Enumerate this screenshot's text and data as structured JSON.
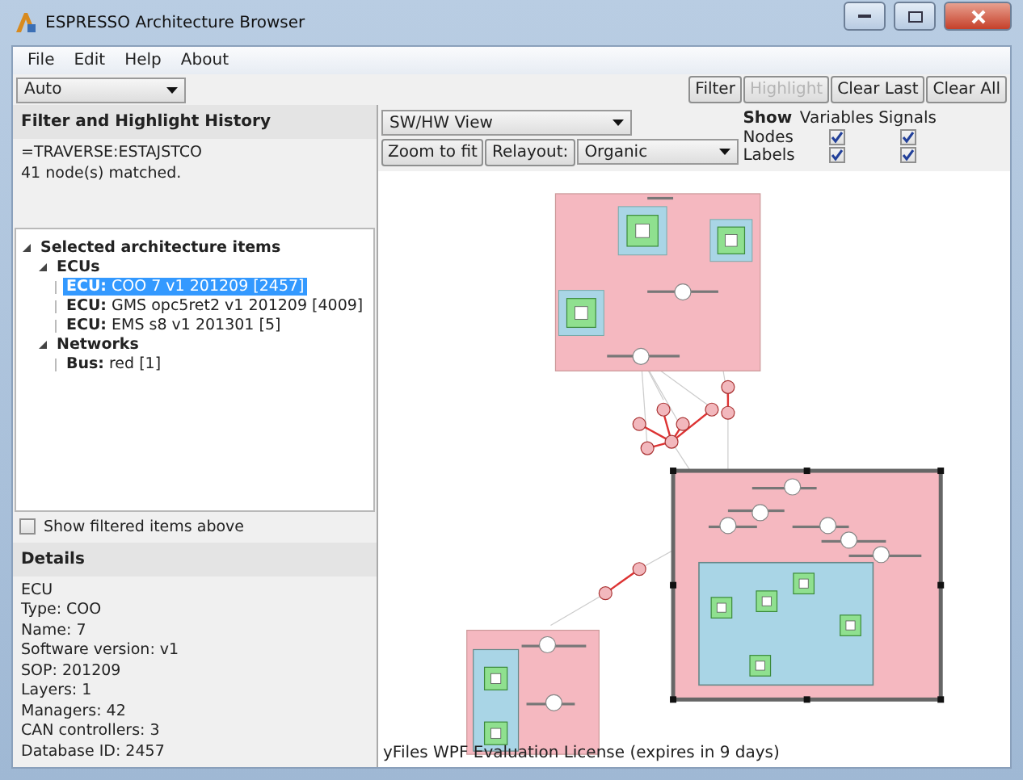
{
  "window": {
    "title": "ESPRESSO Architecture Browser"
  },
  "menu": [
    {
      "label": "File"
    },
    {
      "label": "Edit"
    },
    {
      "label": "Help"
    },
    {
      "label": "About"
    }
  ],
  "toolbar": {
    "mode": "Auto",
    "buttons": [
      {
        "label": "Filter",
        "disabled": false
      },
      {
        "label": "Highlight",
        "disabled": true
      },
      {
        "label": "Clear Last",
        "disabled": false
      },
      {
        "label": "Clear All",
        "disabled": false
      }
    ]
  },
  "history": {
    "title": "Filter and Highlight History",
    "lines": [
      "=TRAVERSE:ESTAJSTCO",
      "41 node(s) matched."
    ]
  },
  "tree": [
    {
      "label": "Selected architecture items",
      "expanded": true,
      "selected": false,
      "children": [
        {
          "label": "ECUs",
          "expanded": true,
          "selected": false,
          "children": [
            {
              "label": "**ECU:** COO 7 v1 201209 [2457]",
              "selected": true
            },
            {
              "label": "**ECU:** GMS opc5ret2 v1 201209 [4009]",
              "selected": false
            },
            {
              "label": "**ECU:** EMS s8 v1 201301 [5]",
              "selected": false
            }
          ]
        },
        {
          "label": "Networks",
          "expanded": true,
          "selected": false,
          "children": [
            {
              "label": "**Bus:** red [1]",
              "selected": false
            }
          ]
        }
      ]
    }
  ],
  "show_filtered": {
    "label": "Show filtered items above",
    "checked": false
  },
  "details": {
    "title": "Details",
    "lines": [
      "ECU",
      "Type: COO",
      "Name: 7",
      "Software version: v1",
      "SOP: 201209",
      "Layers: 1",
      "Managers: 42",
      "CAN controllers: 3",
      "Database ID: 2457"
    ]
  },
  "view": {
    "view_select": "SW/HW View",
    "zoom_button": "Zoom to fit",
    "relayout_button": "Relayout:",
    "layout_select": "Organic"
  },
  "show": {
    "title": "Show",
    "columns": [
      "Variables",
      "Signals"
    ],
    "rows": [
      {
        "label": "Nodes",
        "checks": [
          true,
          true
        ]
      },
      {
        "label": "Labels",
        "checks": [
          true,
          true
        ]
      }
    ]
  },
  "license": "yFiles WPF Evaluation License (expires in 9 days)"
}
